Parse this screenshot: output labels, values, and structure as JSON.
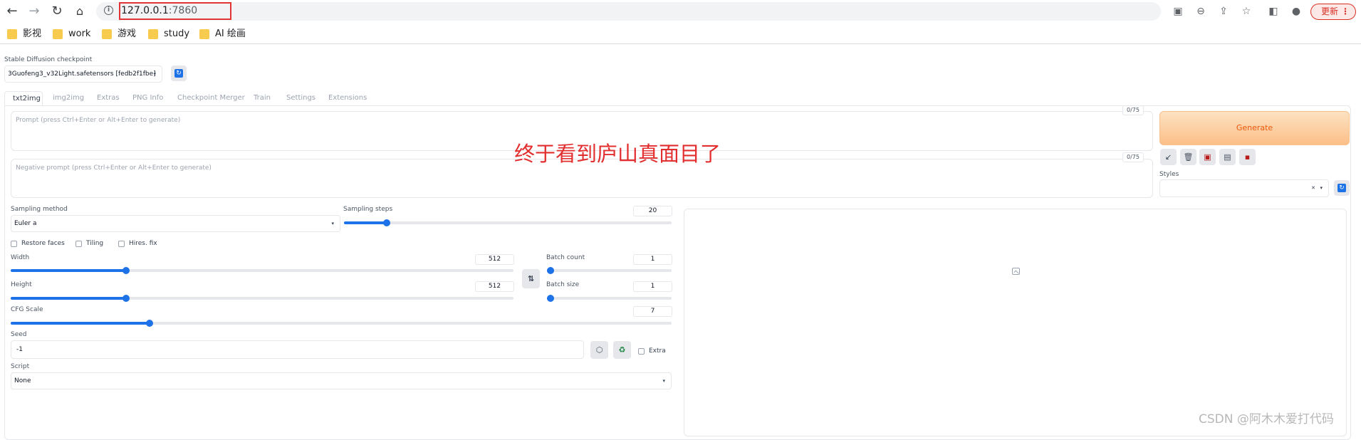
{
  "browser": {
    "url_host": "127.0.0.1",
    "url_port": ":7860",
    "update_label": "更新",
    "bookmarks": [
      "影视",
      "work",
      "游戏",
      "study",
      "AI 绘画"
    ]
  },
  "checkpoint": {
    "label": "Stable Diffusion checkpoint",
    "value": "3Guofeng3_v32Light.safetensors [fedb2f1fbe]"
  },
  "tabs": [
    "txt2img",
    "img2img",
    "Extras",
    "PNG Info",
    "Checkpoint Merger",
    "Train",
    "Settings",
    "Extensions"
  ],
  "prompt": {
    "placeholder": "Prompt (press Ctrl+Enter or Alt+Enter to generate)",
    "counter": "0/75"
  },
  "negative_prompt": {
    "placeholder": "Negative prompt (press Ctrl+Enter or Alt+Enter to generate)",
    "counter": "0/75"
  },
  "generate_label": "Generate",
  "styles_label": "Styles",
  "sampling_method": {
    "label": "Sampling method",
    "value": "Euler a"
  },
  "sampling_steps": {
    "label": "Sampling steps",
    "value": "20",
    "fraction": 0.13
  },
  "checkboxes": {
    "restore_faces": "Restore faces",
    "tiling": "Tiling",
    "hires_fix": "Hires. fix"
  },
  "width": {
    "label": "Width",
    "value": "512",
    "fraction": 0.23
  },
  "height": {
    "label": "Height",
    "value": "512",
    "fraction": 0.23
  },
  "batch_count": {
    "label": "Batch count",
    "value": "1",
    "fraction": 0.0
  },
  "batch_size": {
    "label": "Batch size",
    "value": "1",
    "fraction": 0.0
  },
  "cfg_scale": {
    "label": "CFG Scale",
    "value": "7",
    "fraction": 0.21
  },
  "seed": {
    "label": "Seed",
    "value": "-1",
    "extra_label": "Extra"
  },
  "script": {
    "label": "Script",
    "value": "None"
  },
  "overlay_caption": "终于看到庐山真面目了",
  "watermark": "CSDN @阿木木爱打代码",
  "colors": {
    "accent": "#1d72e8",
    "generate": "#ea580c",
    "annotation": "#e22e2e"
  }
}
